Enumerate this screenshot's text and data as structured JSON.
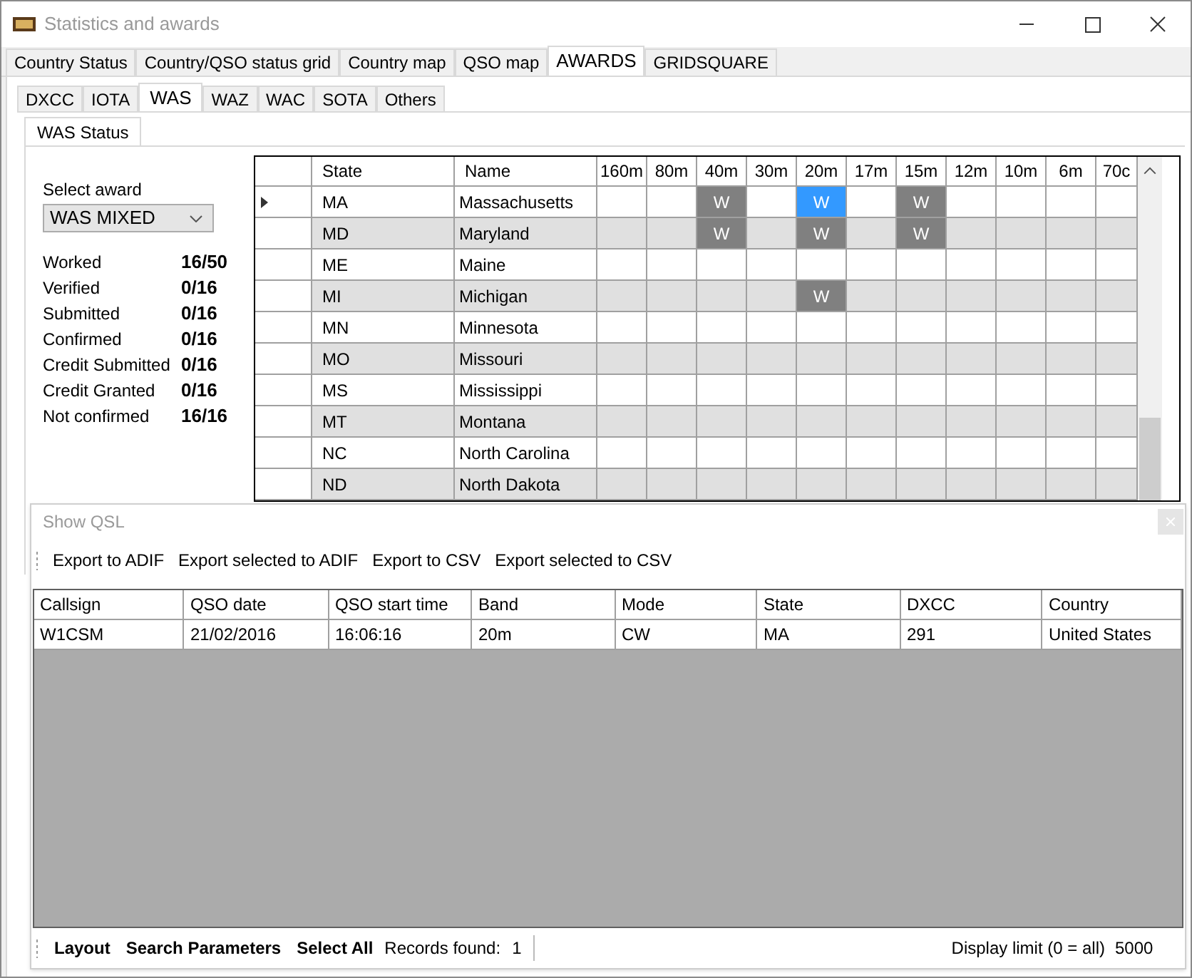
{
  "window": {
    "title": "Statistics and awards"
  },
  "main_tabs": [
    {
      "label": "Country Status",
      "selected": false
    },
    {
      "label": "Country/QSO status grid",
      "selected": false
    },
    {
      "label": "Country map",
      "selected": false
    },
    {
      "label": "QSO map",
      "selected": false
    },
    {
      "label": "AWARDS",
      "selected": true
    },
    {
      "label": "GRIDSQUARE",
      "selected": false
    }
  ],
  "award_tabs": [
    {
      "label": "DXCC",
      "selected": false
    },
    {
      "label": "IOTA",
      "selected": false
    },
    {
      "label": "WAS",
      "selected": true
    },
    {
      "label": "WAZ",
      "selected": false
    },
    {
      "label": "WAC",
      "selected": false
    },
    {
      "label": "SOTA",
      "selected": false
    },
    {
      "label": "Others",
      "selected": false
    }
  ],
  "status_tab": {
    "label": "WAS Status",
    "selected": true
  },
  "award_select": {
    "label": "Select award",
    "value": "WAS MIXED"
  },
  "stats": [
    {
      "label": "Worked",
      "value": "16/50"
    },
    {
      "label": "Verified",
      "value": "0/16"
    },
    {
      "label": "Submitted",
      "value": "0/16"
    },
    {
      "label": "Confirmed",
      "value": "0/16"
    },
    {
      "label": "Credit Submitted",
      "value": "0/16"
    },
    {
      "label": "Credit Granted",
      "value": "0/16"
    },
    {
      "label": "Not confirmed",
      "value": "16/16"
    }
  ],
  "grid": {
    "columns": [
      "State",
      "Name",
      "160m",
      "80m",
      "40m",
      "30m",
      "20m",
      "17m",
      "15m",
      "12m",
      "10m",
      "6m",
      "70c"
    ],
    "rows": [
      {
        "current": true,
        "cells": [
          "MA",
          "Massachusetts",
          "",
          "",
          {
            "text": "W",
            "selected": false
          },
          "",
          {
            "text": "W",
            "selected": true
          },
          "",
          {
            "text": "W",
            "selected": false
          },
          "",
          "",
          "",
          ""
        ]
      },
      {
        "current": false,
        "cells": [
          "MD",
          "Maryland",
          "",
          "",
          {
            "text": "W",
            "selected": false
          },
          "",
          {
            "text": "W",
            "selected": false
          },
          "",
          {
            "text": "W",
            "selected": false
          },
          "",
          "",
          "",
          ""
        ]
      },
      {
        "current": false,
        "cells": [
          "ME",
          "Maine",
          "",
          "",
          "",
          "",
          "",
          "",
          "",
          "",
          "",
          "",
          ""
        ]
      },
      {
        "current": false,
        "cells": [
          "MI",
          "Michigan",
          "",
          "",
          "",
          "",
          {
            "text": "W",
            "selected": false
          },
          "",
          "",
          "",
          "",
          "",
          ""
        ]
      },
      {
        "current": false,
        "cells": [
          "MN",
          "Minnesota",
          "",
          "",
          "",
          "",
          "",
          "",
          "",
          "",
          "",
          "",
          ""
        ]
      },
      {
        "current": false,
        "cells": [
          "MO",
          "Missouri",
          "",
          "",
          "",
          "",
          "",
          "",
          "",
          "",
          "",
          "",
          ""
        ]
      },
      {
        "current": false,
        "cells": [
          "MS",
          "Mississippi",
          "",
          "",
          "",
          "",
          "",
          "",
          "",
          "",
          "",
          "",
          ""
        ]
      },
      {
        "current": false,
        "cells": [
          "MT",
          "Montana",
          "",
          "",
          "",
          "",
          "",
          "",
          "",
          "",
          "",
          "",
          ""
        ]
      },
      {
        "current": false,
        "cells": [
          "NC",
          "North Carolina",
          "",
          "",
          "",
          "",
          "",
          "",
          "",
          "",
          "",
          "",
          ""
        ]
      },
      {
        "current": false,
        "cells": [
          "ND",
          "North Dakota",
          "",
          "",
          "",
          "",
          "",
          "",
          "",
          "",
          "",
          "",
          ""
        ]
      }
    ]
  },
  "qsl_window": {
    "title": "Show QSL",
    "toolbar": [
      "Export to ADIF",
      "Export selected to ADIF",
      "Export to CSV",
      "Export selected to CSV"
    ],
    "table": {
      "columns": [
        "Callsign",
        "QSO date",
        "QSO start time",
        "Band",
        "Mode",
        "State",
        "DXCC",
        "Country"
      ],
      "rows": [
        [
          "W1CSM",
          "21/02/2016",
          "16:06:16",
          "20m",
          "CW",
          "MA",
          "291",
          "United States"
        ]
      ]
    },
    "bottom_bar": {
      "buttons": [
        "Layout",
        "Search Parameters",
        "Select All"
      ],
      "records_label": "Records found:",
      "records_count": "1",
      "limit_label": "Display limit (0 = all)",
      "limit_value": "5000"
    }
  }
}
